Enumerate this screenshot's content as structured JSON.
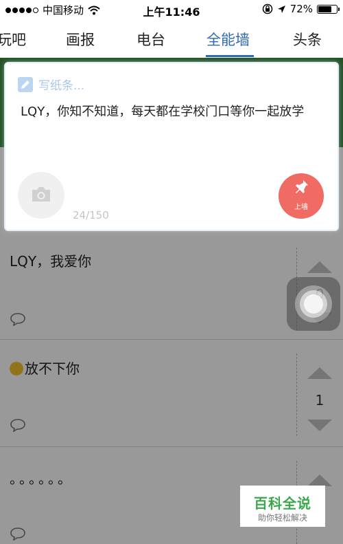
{
  "status_bar": {
    "carrier": "中国移动",
    "time": "上午11:46",
    "battery": "72%",
    "battery_level": 0.72,
    "signal_bars_filled": 4,
    "signal_bars_total": 5
  },
  "tabs": [
    {
      "label": "玩吧",
      "active": false
    },
    {
      "label": "画报",
      "active": false
    },
    {
      "label": "电台",
      "active": false
    },
    {
      "label": "全能墙",
      "active": true
    },
    {
      "label": "头条",
      "active": false
    }
  ],
  "composer": {
    "title": "写纸条...",
    "text": "LQY，你知不知道，每天都在学校门口等你一起放学",
    "counter": "24/150",
    "post_label": "上墙"
  },
  "posts": [
    {
      "text": "LQY，我爱你",
      "votes": "0"
    },
    {
      "text": "放不下你",
      "votes": "1",
      "emoji": "pensive-face"
    },
    {
      "text": "。。。。。。",
      "votes": ""
    }
  ],
  "watermark": {
    "title": "百科全说",
    "subtitle": "助你轻松解决"
  },
  "colors": {
    "accent": "#2e6ab0",
    "post_button": "#f06b63",
    "banner": "#3f8a41",
    "watermark_green": "#3aa84a"
  },
  "icons": [
    "wifi-icon",
    "lock-rotation-icon",
    "location-arrow-icon",
    "pencil-icon",
    "camera-icon",
    "pushpin-icon",
    "comment-icon",
    "vote-up-icon",
    "vote-down-icon",
    "assistive-touch-icon"
  ]
}
